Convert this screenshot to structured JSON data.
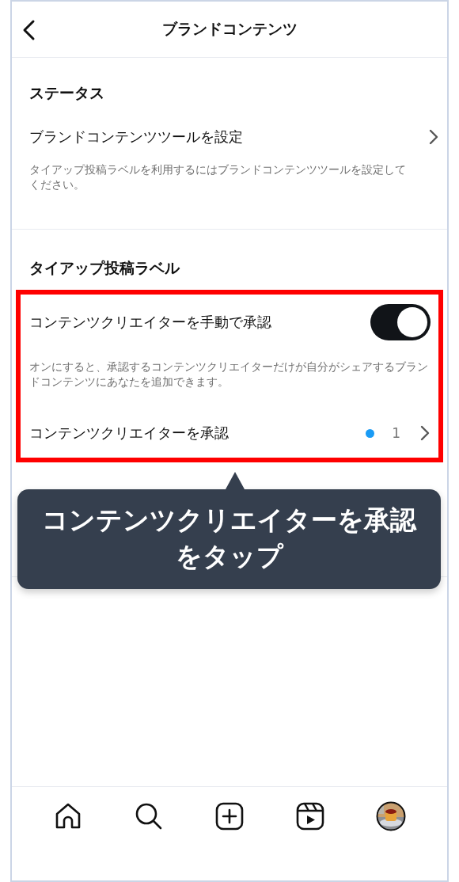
{
  "header": {
    "title": "ブランドコンテンツ"
  },
  "sections": [
    {
      "heading": "ステータス",
      "items": [
        {
          "kind": "link",
          "label": "ブランドコンテンツツールを設定"
        },
        {
          "kind": "note",
          "text": "タイアップ投稿ラベルを利用するにはブランドコンテンツツールを設定してください。"
        }
      ]
    },
    {
      "heading": "タイアップ投稿ラベル",
      "highlighted": true,
      "items": [
        {
          "kind": "toggle",
          "label": "コンテンツクリエイターを手動で承認",
          "on": true
        },
        {
          "kind": "note",
          "text": "オンにすると、承認するコンテンツクリエイターだけが自分がシェアするブランドコンテンツにあなたを追加できます。"
        },
        {
          "kind": "link",
          "label": "コンテンツクリエイターを承認",
          "new_dot": true,
          "count": "1"
        }
      ]
    }
  ],
  "tooltip": {
    "text": "コンテンツクリエイターを承認をタップ"
  },
  "nav": [
    {
      "kind": "home"
    },
    {
      "kind": "search"
    },
    {
      "kind": "create"
    },
    {
      "kind": "reels"
    },
    {
      "kind": "profile"
    }
  ]
}
